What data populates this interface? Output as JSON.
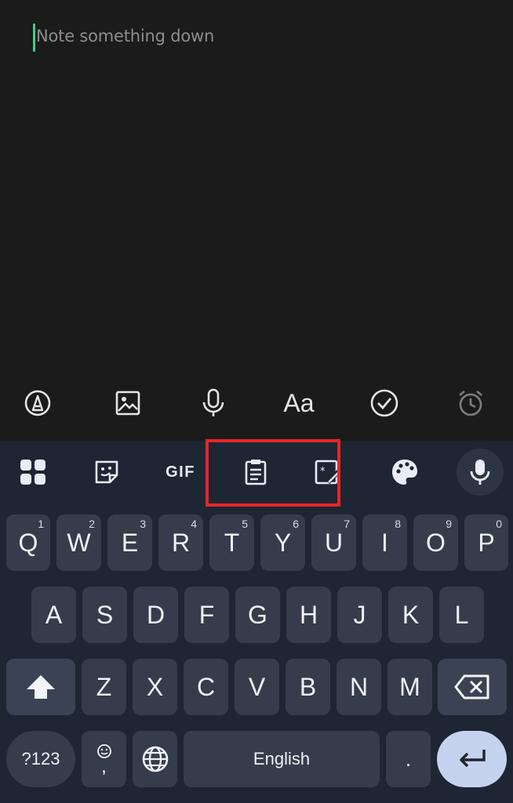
{
  "note": {
    "placeholder": "Note something down"
  },
  "note_toolbar": {
    "icons": [
      "pen-icon",
      "image-icon",
      "microphone-icon",
      "text-format-icon",
      "checkbox-icon",
      "alarm-icon"
    ],
    "text_format_label": "Aa"
  },
  "keyboard_tools": {
    "icons": [
      "apps-grid-icon",
      "sticker-icon",
      "gif-icon",
      "clipboard-icon",
      "text-edit-icon",
      "palette-icon",
      "microphone-icon"
    ],
    "gif_label": "GIF"
  },
  "keys": {
    "row1": [
      {
        "label": "Q",
        "sup": "1"
      },
      {
        "label": "W",
        "sup": "2"
      },
      {
        "label": "E",
        "sup": "3"
      },
      {
        "label": "R",
        "sup": "4"
      },
      {
        "label": "T",
        "sup": "5"
      },
      {
        "label": "Y",
        "sup": "6"
      },
      {
        "label": "U",
        "sup": "7"
      },
      {
        "label": "I",
        "sup": "8"
      },
      {
        "label": "O",
        "sup": "9"
      },
      {
        "label": "P",
        "sup": "0"
      }
    ],
    "row2": [
      "A",
      "S",
      "D",
      "F",
      "G",
      "H",
      "J",
      "K",
      "L"
    ],
    "row3": [
      "Z",
      "X",
      "C",
      "V",
      "B",
      "N",
      "M"
    ],
    "symbols_label": "?123",
    "emoji_comma": ",",
    "space_label": "English",
    "period": "."
  },
  "colors": {
    "accent_caret": "#3ecf8e",
    "highlight_box": "#e8252a",
    "keyboard_bg": "#1e2533",
    "enter_key": "#c6d3ee"
  }
}
